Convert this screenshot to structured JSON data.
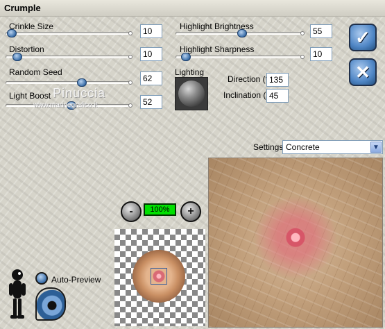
{
  "window": {
    "title": "Crumple"
  },
  "sliders": [
    {
      "label": "Crinkle Size",
      "value": "10",
      "level": 0.03
    },
    {
      "label": "Distortion",
      "value": "10",
      "level": 0.06
    },
    {
      "label": "Random Seed",
      "value": "62",
      "level": 0.59
    },
    {
      "label": "Light Boost",
      "value": "52",
      "level": 0.5
    },
    {
      "label": "Highlight Brightness",
      "value": "55",
      "level": 0.48
    },
    {
      "label": "Highlight Sharpness",
      "value": "10",
      "level": 0.05
    }
  ],
  "lighting": {
    "label": "Lighting"
  },
  "direction": {
    "label": "Direction (°)",
    "value": "135"
  },
  "inclination": {
    "label": "Inclination (°)",
    "value": "45"
  },
  "settings": {
    "label": "Settings:",
    "selected": "Concrete"
  },
  "zoom": {
    "level": "100%"
  },
  "preview": {
    "auto_label": "Auto-Preview"
  },
  "watermark": {
    "name": "Pinuccia",
    "site": "www.marinegrafico.it"
  },
  "icons": {
    "ok": "ok-checkmark-icon",
    "cancel": "cancel-x-icon",
    "zoom_out": "zoom-out-icon",
    "zoom_in": "zoom-in-icon",
    "eye": "eye-icon",
    "figure": "help-figure-icon"
  },
  "colors": {
    "thumb": "#3a6ea8",
    "zoom_bg": "#00e000"
  }
}
